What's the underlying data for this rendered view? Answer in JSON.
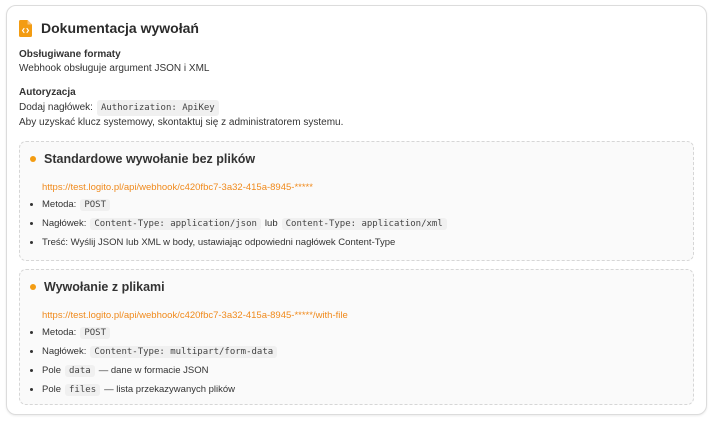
{
  "header": {
    "title": "Dokumentacja wywołań",
    "icon": "document-code-icon",
    "accent": "#f39c12"
  },
  "formats": {
    "label": "Obsługiwane formaty",
    "text": "Webhook obsługuje argument JSON i XML"
  },
  "auth": {
    "label": "Autoryzacja",
    "header_prefix": "Dodaj nagłówek:",
    "header_code": "Authorization: ApiKey",
    "note": "Aby uzyskać klucz systemowy, skontaktuj się z administratorem systemu."
  },
  "sections": [
    {
      "title": "Standardowe wywołanie bez plików",
      "url": "https://test.logito.pl/api/webhook/c420fbc7-3a32-415a-8945-*****",
      "items": {
        "method_label": "Metoda:",
        "method_code": "POST",
        "header_label": "Nagłówek:",
        "header_code_1": "Content-Type: application/json",
        "header_or": "lub",
        "header_code_2": "Content-Type: application/xml",
        "body_text": "Treść: Wyślij JSON lub XML w body, ustawiając odpowiedni nagłówek Content-Type"
      }
    },
    {
      "title": "Wywołanie z plikami",
      "url": "https://test.logito.pl/api/webhook/c420fbc7-3a32-415a-8945-*****/with-file",
      "items": {
        "method_label": "Metoda:",
        "method_code": "POST",
        "header_label": "Nagłówek:",
        "header_code": "Content-Type: multipart/form-data",
        "field_label": "Pole",
        "data_code": "data",
        "data_desc": "— dane w formacie JSON",
        "files_code": "files",
        "files_desc": "— lista przekazywanych plików"
      }
    }
  ]
}
